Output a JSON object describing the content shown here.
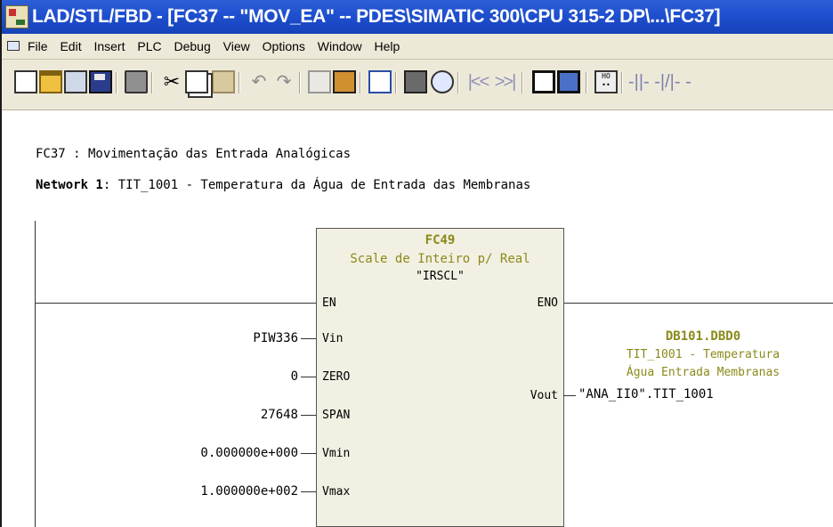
{
  "window": {
    "title": "LAD/STL/FBD  - [FC37 -- \"MOV_EA\" -- PDES\\SIMATIC 300\\CPU 315-2 DP\\...\\FC37]"
  },
  "menu": {
    "items": [
      "File",
      "Edit",
      "Insert",
      "PLC",
      "Debug",
      "View",
      "Options",
      "Window",
      "Help"
    ]
  },
  "toolbar": {
    "icons": [
      "new-icon",
      "open-icon",
      "accessible-nodes-icon",
      "save-icon",
      "print-icon",
      "cut-icon",
      "copy-icon",
      "paste-icon",
      "undo-icon",
      "redo-icon",
      "simulation-icon",
      "download-icon",
      "overview-icon",
      "monitor-icon",
      "glasses-icon",
      "prev-icon",
      "next-icon",
      "details-window-icon",
      "program-elements-icon",
      "io-icon",
      "contact-icons"
    ]
  },
  "editor": {
    "block_comment": "FC37 : Movimentação das Entrada Analógicas",
    "network_label": "Network 1",
    "network_title": ": TIT_1001 - Temperatura da Água de Entrada das Membranas",
    "block": {
      "name": "FC49",
      "description": "Scale de Inteiro p/ Real",
      "symbol": "\"IRSCL\"",
      "en": "EN",
      "eno": "ENO",
      "inputs": [
        {
          "pin": "Vin",
          "actual": "PIW336"
        },
        {
          "pin": "ZERO",
          "actual": "0"
        },
        {
          "pin": "SPAN",
          "actual": "27648"
        },
        {
          "pin": "Vmin",
          "actual": "0.000000e+000"
        },
        {
          "pin": "Vmax",
          "actual": "1.000000e+002"
        }
      ],
      "output": {
        "pin": "Vout",
        "address": "DB101.DBD0",
        "comment_line1": "TIT_1001 - Temperatura",
        "comment_line2": "Água Entrada Membranas",
        "variable": "\"ANA_II0\".TIT_1001"
      }
    }
  }
}
